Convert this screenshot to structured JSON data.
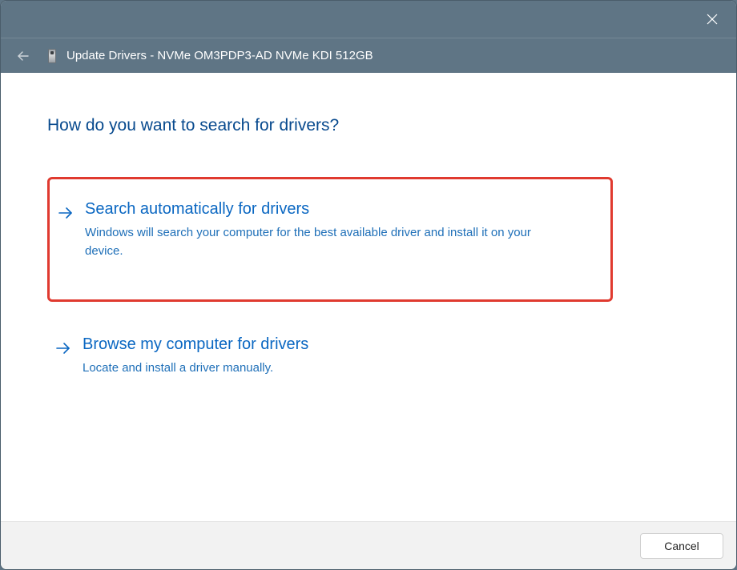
{
  "window": {
    "title": "Update Drivers - NVMe OM3PDP3-AD NVMe KDI 512GB"
  },
  "heading": "How do you want to search for drivers?",
  "options": [
    {
      "title": "Search automatically for drivers",
      "description": "Windows will search your computer for the best available driver and install it on your device.",
      "highlighted": true
    },
    {
      "title": "Browse my computer for drivers",
      "description": "Locate and install a driver manually.",
      "highlighted": false
    }
  ],
  "footer": {
    "cancel_label": "Cancel"
  }
}
